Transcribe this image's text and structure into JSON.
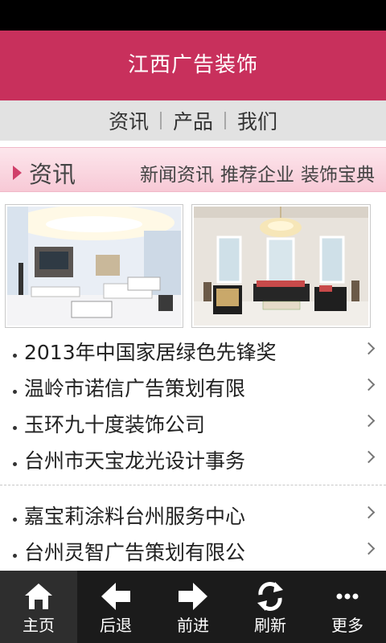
{
  "app": {
    "title": "江西广告装饰"
  },
  "topnav": {
    "items": [
      "资讯",
      "产品",
      "我们"
    ]
  },
  "section": {
    "title": "资讯",
    "links": [
      "新闻资讯",
      "推荐企业",
      "装饰宝典"
    ]
  },
  "list_group_1": [
    "2013年中国家居绿色先锋奖",
    "温岭市诺信广告策划有限",
    "玉环九十度装饰公司",
    "台州市天宝龙光设计事务"
  ],
  "list_group_2": [
    "嘉宝莉涂料台州服务中心",
    "台州灵智广告策划有限公"
  ],
  "bottombar": {
    "home": "主页",
    "back": "后退",
    "forward": "前进",
    "refresh": "刷新",
    "more": "更多"
  },
  "colors": {
    "brand": "#c8305c",
    "section_bg": "#f7c9d6",
    "bottombar": "#1b1b1b"
  },
  "icons": [
    "home-icon",
    "back-arrow-icon",
    "forward-arrow-icon",
    "refresh-icon",
    "more-icon",
    "chevron-right-icon"
  ]
}
